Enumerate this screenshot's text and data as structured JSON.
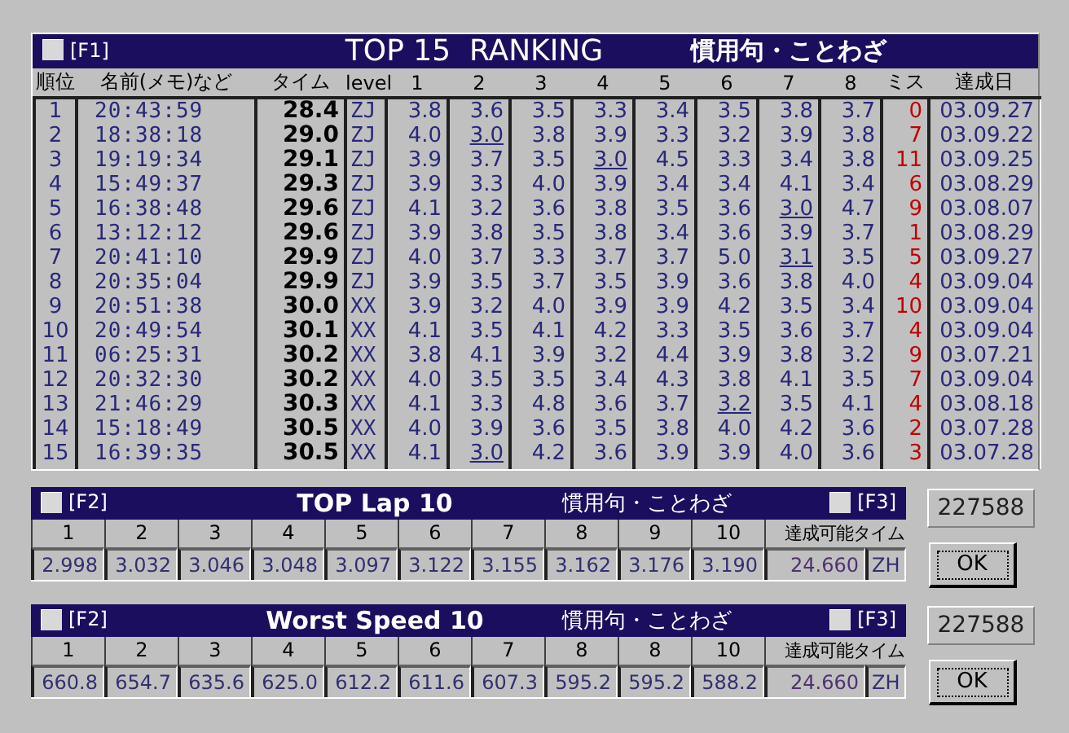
{
  "ranking": {
    "checkbox": {
      "label": "[F1]",
      "checked": false
    },
    "title": "TOP 15  RANKING",
    "subtitle": "慣用句・ことわざ",
    "columns": [
      "順位",
      "名前(メモ)など",
      "タイム",
      "level",
      "1",
      "2",
      "3",
      "4",
      "5",
      "6",
      "7",
      "8",
      "ミス",
      "達成日"
    ],
    "rows": [
      {
        "rank": "1",
        "name": "20:43:59",
        "time": "28.4",
        "level": "ZJ",
        "sections": [
          {
            "value": "3.8",
            "underlined": false
          },
          {
            "value": "3.6",
            "underlined": false
          },
          {
            "value": "3.5",
            "underlined": false
          },
          {
            "value": "3.3",
            "underlined": false
          },
          {
            "value": "3.4",
            "underlined": false
          },
          {
            "value": "3.5",
            "underlined": false
          },
          {
            "value": "3.8",
            "underlined": false
          },
          {
            "value": "3.7",
            "underlined": false
          }
        ],
        "misses": "0",
        "date": "03.09.27"
      },
      {
        "rank": "2",
        "name": "18:38:18",
        "time": "29.0",
        "level": "ZJ",
        "sections": [
          {
            "value": "4.0",
            "underlined": false
          },
          {
            "value": "3.0",
            "underlined": true
          },
          {
            "value": "3.8",
            "underlined": false
          },
          {
            "value": "3.9",
            "underlined": false
          },
          {
            "value": "3.3",
            "underlined": false
          },
          {
            "value": "3.2",
            "underlined": false
          },
          {
            "value": "3.9",
            "underlined": false
          },
          {
            "value": "3.8",
            "underlined": false
          }
        ],
        "misses": "7",
        "date": "03.09.22"
      },
      {
        "rank": "3",
        "name": "19:19:34",
        "time": "29.1",
        "level": "ZJ",
        "sections": [
          {
            "value": "3.9",
            "underlined": false
          },
          {
            "value": "3.7",
            "underlined": false
          },
          {
            "value": "3.5",
            "underlined": false
          },
          {
            "value": "3.0",
            "underlined": true
          },
          {
            "value": "4.5",
            "underlined": false
          },
          {
            "value": "3.3",
            "underlined": false
          },
          {
            "value": "3.4",
            "underlined": false
          },
          {
            "value": "3.8",
            "underlined": false
          }
        ],
        "misses": "11",
        "date": "03.09.25"
      },
      {
        "rank": "4",
        "name": "15:49:37",
        "time": "29.3",
        "level": "ZJ",
        "sections": [
          {
            "value": "3.9",
            "underlined": false
          },
          {
            "value": "3.3",
            "underlined": false
          },
          {
            "value": "4.0",
            "underlined": false
          },
          {
            "value": "3.9",
            "underlined": false
          },
          {
            "value": "3.4",
            "underlined": false
          },
          {
            "value": "3.4",
            "underlined": false
          },
          {
            "value": "4.1",
            "underlined": false
          },
          {
            "value": "3.4",
            "underlined": false
          }
        ],
        "misses": "6",
        "date": "03.08.29"
      },
      {
        "rank": "5",
        "name": "16:38:48",
        "time": "29.6",
        "level": "ZJ",
        "sections": [
          {
            "value": "4.1",
            "underlined": false
          },
          {
            "value": "3.2",
            "underlined": false
          },
          {
            "value": "3.6",
            "underlined": false
          },
          {
            "value": "3.8",
            "underlined": false
          },
          {
            "value": "3.5",
            "underlined": false
          },
          {
            "value": "3.6",
            "underlined": false
          },
          {
            "value": "3.0",
            "underlined": true
          },
          {
            "value": "4.7",
            "underlined": false
          }
        ],
        "misses": "9",
        "date": "03.08.07"
      },
      {
        "rank": "6",
        "name": "13:12:12",
        "time": "29.6",
        "level": "ZJ",
        "sections": [
          {
            "value": "3.9",
            "underlined": false
          },
          {
            "value": "3.8",
            "underlined": false
          },
          {
            "value": "3.5",
            "underlined": false
          },
          {
            "value": "3.8",
            "underlined": false
          },
          {
            "value": "3.4",
            "underlined": false
          },
          {
            "value": "3.6",
            "underlined": false
          },
          {
            "value": "3.9",
            "underlined": false
          },
          {
            "value": "3.7",
            "underlined": false
          }
        ],
        "misses": "1",
        "date": "03.08.29"
      },
      {
        "rank": "7",
        "name": "20:41:10",
        "time": "29.9",
        "level": "ZJ",
        "sections": [
          {
            "value": "4.0",
            "underlined": false
          },
          {
            "value": "3.7",
            "underlined": false
          },
          {
            "value": "3.3",
            "underlined": false
          },
          {
            "value": "3.7",
            "underlined": false
          },
          {
            "value": "3.7",
            "underlined": false
          },
          {
            "value": "5.0",
            "underlined": false
          },
          {
            "value": "3.1",
            "underlined": true
          },
          {
            "value": "3.5",
            "underlined": false
          }
        ],
        "misses": "5",
        "date": "03.09.27"
      },
      {
        "rank": "8",
        "name": "20:35:04",
        "time": "29.9",
        "level": "ZJ",
        "sections": [
          {
            "value": "3.9",
            "underlined": false
          },
          {
            "value": "3.5",
            "underlined": false
          },
          {
            "value": "3.7",
            "underlined": false
          },
          {
            "value": "3.5",
            "underlined": false
          },
          {
            "value": "3.9",
            "underlined": false
          },
          {
            "value": "3.6",
            "underlined": false
          },
          {
            "value": "3.8",
            "underlined": false
          },
          {
            "value": "4.0",
            "underlined": false
          }
        ],
        "misses": "4",
        "date": "03.09.04"
      },
      {
        "rank": "9",
        "name": "20:51:38",
        "time": "30.0",
        "level": "XX",
        "sections": [
          {
            "value": "3.9",
            "underlined": false
          },
          {
            "value": "3.2",
            "underlined": false
          },
          {
            "value": "4.0",
            "underlined": false
          },
          {
            "value": "3.9",
            "underlined": false
          },
          {
            "value": "3.9",
            "underlined": false
          },
          {
            "value": "4.2",
            "underlined": false
          },
          {
            "value": "3.5",
            "underlined": false
          },
          {
            "value": "3.4",
            "underlined": false
          }
        ],
        "misses": "10",
        "date": "03.09.04"
      },
      {
        "rank": "10",
        "name": "20:49:54",
        "time": "30.1",
        "level": "XX",
        "sections": [
          {
            "value": "4.1",
            "underlined": false
          },
          {
            "value": "3.5",
            "underlined": false
          },
          {
            "value": "4.1",
            "underlined": false
          },
          {
            "value": "4.2",
            "underlined": false
          },
          {
            "value": "3.3",
            "underlined": false
          },
          {
            "value": "3.5",
            "underlined": false
          },
          {
            "value": "3.6",
            "underlined": false
          },
          {
            "value": "3.7",
            "underlined": false
          }
        ],
        "misses": "4",
        "date": "03.09.04"
      },
      {
        "rank": "11",
        "name": "06:25:31",
        "time": "30.2",
        "level": "XX",
        "sections": [
          {
            "value": "3.8",
            "underlined": false
          },
          {
            "value": "4.1",
            "underlined": false
          },
          {
            "value": "3.9",
            "underlined": false
          },
          {
            "value": "3.2",
            "underlined": false
          },
          {
            "value": "4.4",
            "underlined": false
          },
          {
            "value": "3.9",
            "underlined": false
          },
          {
            "value": "3.8",
            "underlined": false
          },
          {
            "value": "3.2",
            "underlined": false
          }
        ],
        "misses": "9",
        "date": "03.07.21"
      },
      {
        "rank": "12",
        "name": "20:32:30",
        "time": "30.2",
        "level": "XX",
        "sections": [
          {
            "value": "4.0",
            "underlined": false
          },
          {
            "value": "3.5",
            "underlined": false
          },
          {
            "value": "3.5",
            "underlined": false
          },
          {
            "value": "3.4",
            "underlined": false
          },
          {
            "value": "4.3",
            "underlined": false
          },
          {
            "value": "3.8",
            "underlined": false
          },
          {
            "value": "4.1",
            "underlined": false
          },
          {
            "value": "3.5",
            "underlined": false
          }
        ],
        "misses": "7",
        "date": "03.09.04"
      },
      {
        "rank": "13",
        "name": "21:46:29",
        "time": "30.3",
        "level": "XX",
        "sections": [
          {
            "value": "4.1",
            "underlined": false
          },
          {
            "value": "3.3",
            "underlined": false
          },
          {
            "value": "4.8",
            "underlined": false
          },
          {
            "value": "3.6",
            "underlined": false
          },
          {
            "value": "3.7",
            "underlined": false
          },
          {
            "value": "3.2",
            "underlined": true
          },
          {
            "value": "3.5",
            "underlined": false
          },
          {
            "value": "4.1",
            "underlined": false
          }
        ],
        "misses": "4",
        "date": "03.08.18"
      },
      {
        "rank": "14",
        "name": "15:18:49",
        "time": "30.5",
        "level": "XX",
        "sections": [
          {
            "value": "4.0",
            "underlined": false
          },
          {
            "value": "3.9",
            "underlined": false
          },
          {
            "value": "3.6",
            "underlined": false
          },
          {
            "value": "3.5",
            "underlined": false
          },
          {
            "value": "3.8",
            "underlined": false
          },
          {
            "value": "4.0",
            "underlined": false
          },
          {
            "value": "4.2",
            "underlined": false
          },
          {
            "value": "3.6",
            "underlined": false
          }
        ],
        "misses": "2",
        "date": "03.07.28"
      },
      {
        "rank": "15",
        "name": "16:39:35",
        "time": "30.5",
        "level": "XX",
        "sections": [
          {
            "value": "4.1",
            "underlined": false
          },
          {
            "value": "3.0",
            "underlined": true
          },
          {
            "value": "4.2",
            "underlined": false
          },
          {
            "value": "3.6",
            "underlined": false
          },
          {
            "value": "3.9",
            "underlined": false
          },
          {
            "value": "3.9",
            "underlined": false
          },
          {
            "value": "4.0",
            "underlined": false
          },
          {
            "value": "3.6",
            "underlined": false
          }
        ],
        "misses": "3",
        "date": "03.07.28"
      }
    ]
  },
  "panels": [
    {
      "left_checkbox": {
        "label": "[F2]",
        "checked": false
      },
      "title": "TOP Lap 10",
      "subtitle": "慣用句・ことわざ",
      "right_checkbox": {
        "label": "[F3]",
        "checked": false
      },
      "columns": [
        "1",
        "2",
        "3",
        "4",
        "5",
        "6",
        "7",
        "8",
        "9",
        "10",
        "達成可能タイム"
      ],
      "values": [
        "2.998",
        "3.032",
        "3.046",
        "3.048",
        "3.097",
        "3.122",
        "3.155",
        "3.162",
        "3.176",
        "3.190"
      ],
      "target_time": "24.660",
      "level": "ZH",
      "counter": "227588",
      "button": "OK"
    },
    {
      "left_checkbox": {
        "label": "[F2]",
        "checked": false
      },
      "title": "Worst Speed 10",
      "subtitle": "慣用句・ことわざ",
      "right_checkbox": {
        "label": "[F3]",
        "checked": false
      },
      "columns": [
        "1",
        "2",
        "3",
        "4",
        "5",
        "6",
        "7",
        "8",
        "8",
        "10",
        "達成可能タイム"
      ],
      "values": [
        "660.8",
        "654.7",
        "635.6",
        "625.0",
        "612.2",
        "611.6",
        "607.3",
        "595.2",
        "595.2",
        "588.2"
      ],
      "target_time": "24.660",
      "level": "ZH",
      "counter": "227588",
      "button": "OK"
    }
  ]
}
